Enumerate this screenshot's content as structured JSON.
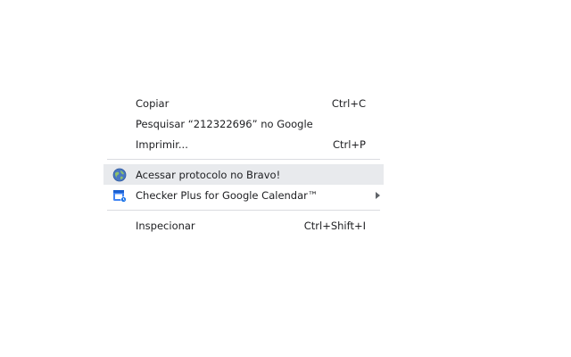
{
  "menu": {
    "items": [
      {
        "label": "Copiar",
        "shortcut": "Ctrl+C"
      },
      {
        "label": "Pesquisar “212322696” no Google",
        "shortcut": ""
      },
      {
        "label": "Imprimir...",
        "shortcut": "Ctrl+P"
      },
      {
        "label": "Acessar protocolo no Bravo!",
        "shortcut": "",
        "icon": "globe-icon"
      },
      {
        "label": "Checker Plus for Google Calendar™",
        "shortcut": "",
        "icon": "calendar-icon"
      },
      {
        "label": "Inspecionar",
        "shortcut": "Ctrl+Shift+I"
      }
    ]
  },
  "colors": {
    "hover": "#e8eaed",
    "text": "#202124",
    "separator": "#dadce0",
    "icon_blue": "#1a73e8"
  }
}
